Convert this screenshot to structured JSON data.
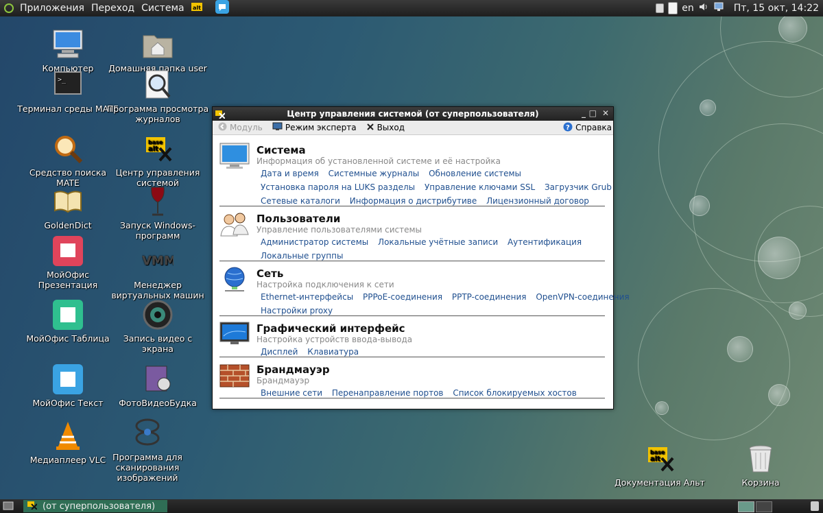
{
  "top_panel": {
    "menus": [
      "Приложения",
      "Переход",
      "Система"
    ],
    "lang": "en",
    "clock": "Пт, 15 окт, 14:22"
  },
  "desktop": {
    "icons": [
      {
        "label": "Компьютер",
        "icon": "computer-icon"
      },
      {
        "label": "Домашняя папка user",
        "icon": "home-folder-icon"
      },
      {
        "label": "Терминал среды MATE",
        "icon": "terminal-icon"
      },
      {
        "label": "Программа просмотра журналов",
        "icon": "log-viewer-icon"
      },
      {
        "label": "Средство поиска MATE",
        "icon": "search-tool-icon"
      },
      {
        "label": "Центр управления системой",
        "icon": "basealt-control-center-icon"
      },
      {
        "label": "GoldenDict",
        "icon": "dictionary-book-icon"
      },
      {
        "label": "Запуск Windows-программ",
        "icon": "wine-glass-icon"
      },
      {
        "label": "МойОфис Презентация",
        "icon": "myoffice-presentation-icon"
      },
      {
        "label": "Менеджер виртуальных машин",
        "icon": "vmm-icon"
      },
      {
        "label": "МойОфис Таблица",
        "icon": "myoffice-spreadsheet-icon"
      },
      {
        "label": "Запись видео с экрана",
        "icon": "screen-recorder-icon"
      },
      {
        "label": "МойОфис Текст",
        "icon": "myoffice-text-icon"
      },
      {
        "label": "ФотоВидеоБудка",
        "icon": "photo-booth-icon"
      },
      {
        "label": "Медиаплеер VLC",
        "icon": "vlc-cone-icon"
      },
      {
        "label": "Программа для сканирования изображений",
        "icon": "scanner-icon"
      },
      {
        "label": "Документация Альт",
        "icon": "basealt-docs-icon"
      },
      {
        "label": "Корзина",
        "icon": "trash-icon"
      }
    ]
  },
  "window": {
    "title": "Центр управления системой (от суперпользователя)",
    "toolbar": {
      "module": "Модуль",
      "expert": "Режим эксперта",
      "exit": "Выход",
      "help": "Справка"
    },
    "sections": [
      {
        "title": "Система",
        "desc": "Информация об установленной системе и её настройка",
        "icon": "monitor-icon",
        "rows": [
          [
            "Дата и время",
            "Системные журналы",
            "Обновление системы"
          ],
          [
            "Установка пароля на LUKS разделы",
            "Управление ключами SSL",
            "Загрузчик Grub"
          ],
          [
            "Сетевые каталоги",
            "Информация о дистрибутиве",
            "Лицензионный договор"
          ]
        ]
      },
      {
        "title": "Пользователи",
        "desc": "Управление пользователями системы",
        "icon": "users-icon",
        "rows": [
          [
            "Администратор системы",
            "Локальные учётные записи",
            "Аутентификация"
          ],
          [
            "Локальные группы"
          ]
        ]
      },
      {
        "title": "Сеть",
        "desc": "Настройка подключения к сети",
        "icon": "globe-network-icon",
        "rows": [
          [
            "Ethernet-интерфейсы",
            "PPPoE-соединения",
            "PPTP-соединения",
            "OpenVPN-соединения"
          ],
          [
            "Настройки proxy"
          ]
        ]
      },
      {
        "title": "Графический интерфейс",
        "desc": "Настройка устройств ввода-вывода",
        "icon": "display-icon",
        "rows": [
          [
            "Дисплей",
            "Клавиатура"
          ]
        ]
      },
      {
        "title": "Брандмауэр",
        "desc": "Брандмауэр",
        "icon": "brick-wall-icon",
        "rows": [
          [
            "Внешние сети",
            "Перенаправление портов",
            "Список блокируемых хостов"
          ]
        ]
      }
    ]
  },
  "bottom_panel": {
    "task_label": "(от суперпользователя)"
  },
  "colors": {
    "link": "#1f4f8f",
    "task_active": "#2f6e55",
    "mate_green": "#8ec63f"
  }
}
